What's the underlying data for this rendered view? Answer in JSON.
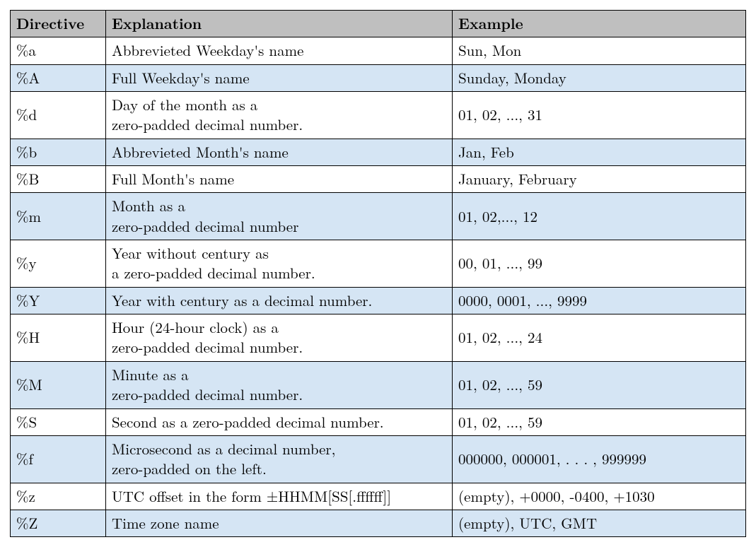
{
  "headers": {
    "c1": "Directive",
    "c2": "Explanation",
    "c3": "Example"
  },
  "rows": [
    {
      "alt": false,
      "directive": "%a",
      "explanation": "Abbrevieted Weekday's name",
      "example": "Sun, Mon"
    },
    {
      "alt": true,
      "directive": "%A",
      "explanation": "Full Weekday's name",
      "example": "Sunday, Monday"
    },
    {
      "alt": false,
      "directive": "%d",
      "explanation": "Day of the month as a\nzero-padded decimal number.",
      "example": "01, 02, ..., 31"
    },
    {
      "alt": true,
      "directive": "%b",
      "explanation": "Abbrevieted Month's name",
      "example": "Jan, Feb"
    },
    {
      "alt": false,
      "directive": "%B",
      "explanation": "Full Month's name",
      "example": "January, February"
    },
    {
      "alt": true,
      "directive": "%m",
      "explanation": "Month as a\nzero-padded decimal number",
      "example": "01, 02,..., 12"
    },
    {
      "alt": false,
      "directive": "%y",
      "explanation": "Year without century as\na zero-padded decimal number.",
      "example": "00, 01, ..., 99"
    },
    {
      "alt": true,
      "directive": "%Y",
      "explanation": "Year with century as a decimal number.",
      "example": "0000, 0001, ..., 9999"
    },
    {
      "alt": false,
      "directive": "%H",
      "explanation": "Hour (24-hour clock) as a\nzero-padded decimal number.",
      "example": "01, 02, ..., 24"
    },
    {
      "alt": true,
      "directive": "%M",
      "explanation": "Minute as a\nzero-padded decimal number.",
      "example": "01, 02, ..., 59"
    },
    {
      "alt": false,
      "directive": "%S",
      "explanation": "Second as a zero-padded decimal number.",
      "example": "01, 02, ..., 59"
    },
    {
      "alt": true,
      "directive": "%f",
      "explanation": "Microsecond as a decimal number,\nzero-padded on the left.",
      "example": "000000, 000001, . . . , 999999"
    },
    {
      "alt": false,
      "directive": "%z",
      "explanation": "UTC offset in the form ±HHMM[SS[.ffffff]]",
      "example": "(empty), +0000, -0400, +1030"
    },
    {
      "alt": true,
      "directive": "%Z",
      "explanation": "Time zone name",
      "example": "(empty), UTC, GMT"
    }
  ]
}
